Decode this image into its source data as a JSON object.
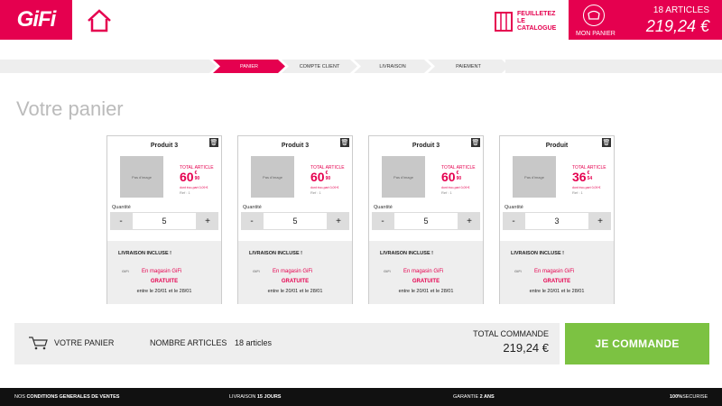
{
  "header": {
    "logo": "GiFi",
    "catalog_line1": "FEUILLETEZ",
    "catalog_line2": "LE",
    "catalog_line3": "CATALOGUE",
    "cart_label": "MON PANIER",
    "cart_count": "18 ARTICLES",
    "cart_total": "219,24 €",
    "brand_color": "#e5004f"
  },
  "steps": [
    "PANIER",
    "COMPTE CLIENT",
    "LIVRAISON",
    "PAIEMENT"
  ],
  "active_step": "PANIER",
  "page_title": "Votre panier",
  "products": [
    {
      "name": "Produit 3",
      "image_alt": "Pas d'image",
      "total_label": "TOTAL ARTICLE",
      "price_int": "60",
      "price_cur": "€",
      "price_dec": "90",
      "eco": "dont éco-part 0,09 €",
      "ref": "Ref : 1",
      "qty_label": "Quantité",
      "qty": "5",
      "delivery_title": "LIVRAISON INCLUSE !",
      "store_logo": "GiFi",
      "store_text": "En magasin GiFi",
      "free": "GRATUITE",
      "dates": "entre le 20/01 et le 28/01"
    },
    {
      "name": "Produit 3",
      "image_alt": "Pas d'image",
      "total_label": "TOTAL ARTICLE",
      "price_int": "60",
      "price_cur": "€",
      "price_dec": "90",
      "eco": "dont éco-part 0,09 €",
      "ref": "Ref : 1",
      "qty_label": "Quantité",
      "qty": "5",
      "delivery_title": "LIVRAISON INCLUSE !",
      "store_logo": "GiFi",
      "store_text": "En magasin GiFi",
      "free": "GRATUITE",
      "dates": "entre le 20/01 et le 28/01"
    },
    {
      "name": "Produit 3",
      "image_alt": "Pas d'image",
      "total_label": "TOTAL ARTICLE",
      "price_int": "60",
      "price_cur": "€",
      "price_dec": "90",
      "eco": "dont éco-part 0,09 €",
      "ref": "Ref : 1",
      "qty_label": "Quantité",
      "qty": "5",
      "delivery_title": "LIVRAISON INCLUSE !",
      "store_logo": "GiFi",
      "store_text": "En magasin GiFi",
      "free": "GRATUITE",
      "dates": "entre le 20/01 et le 28/01"
    },
    {
      "name": "Produit",
      "image_alt": "Pas d'image",
      "total_label": "TOTAL ARTICLE",
      "price_int": "36",
      "price_cur": "€",
      "price_dec": "54",
      "eco": "dont éco-part 0,09 €",
      "ref": "Ref : 1",
      "qty_label": "Quantité",
      "qty": "3",
      "delivery_title": "LIVRAISON INCLUSE !",
      "store_logo": "GiFi",
      "store_text": "En magasin GiFi",
      "free": "GRATUITE",
      "dates": "entre le 20/01 et le 28/01"
    }
  ],
  "summary": {
    "cart_label": "VOTRE PANIER",
    "articles_label": "NOMBRE ARTICLES",
    "articles_value": "18 articles",
    "total_label": "TOTAL COMMANDE",
    "total_value": "219,24 €",
    "order_button": "JE COMMANDE",
    "order_color": "#7cc242"
  },
  "footer": {
    "conditions_prefix": "NOS",
    "conditions": "CONDITIONS GENERALES DE VENTES",
    "delivery_prefix": "LIVRAISON",
    "delivery": "15 JOURS",
    "warranty_prefix": "GARANTIE",
    "warranty": "2 ANS",
    "secure_prefix": "100%",
    "secure": "SECURISE"
  }
}
